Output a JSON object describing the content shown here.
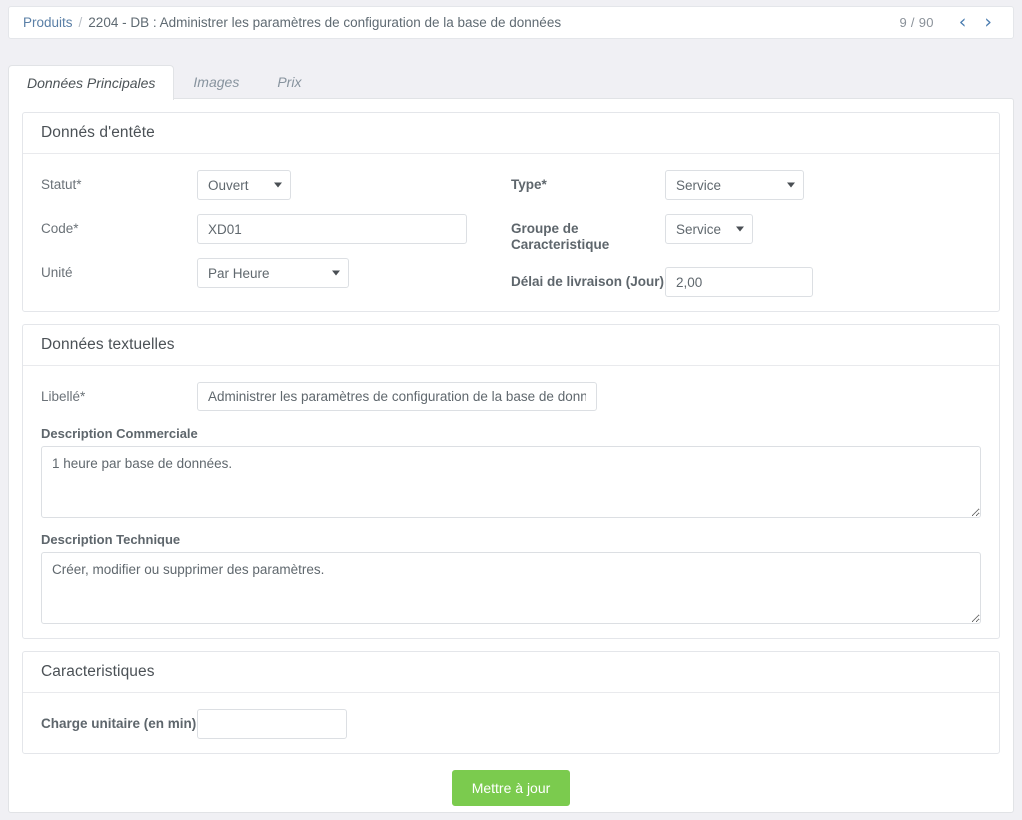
{
  "breadcrumb": {
    "root": "Produits",
    "separator": "/",
    "current": "2204 - DB : Administrer les paramètres de configuration de la base de données"
  },
  "pager": {
    "count": "9 / 90",
    "prev_icon": "chevron-left-icon",
    "prev_glyph": "‹",
    "next_icon": "chevron-right-icon",
    "next_glyph": "›"
  },
  "tabs": [
    {
      "label": "Données Principales",
      "active": true
    },
    {
      "label": "Images",
      "active": false
    },
    {
      "label": "Prix",
      "active": false
    }
  ],
  "panels": {
    "header_data": {
      "title": "Donnés d'entête",
      "fields": {
        "statut": {
          "label": "Statut*",
          "value": "Ouvert"
        },
        "code": {
          "label": "Code*",
          "value": "XD01",
          "placeholder": ""
        },
        "unite": {
          "label": "Unité",
          "value": "Par Heure"
        },
        "type": {
          "label": "Type*",
          "value": "Service"
        },
        "groupe": {
          "label": "Groupe de Caracteristique",
          "value": "Service"
        },
        "delai": {
          "label": "Délai de livraison (Jour)",
          "value": "2,00",
          "placeholder": ""
        }
      }
    },
    "text_data": {
      "title": "Données textuelles",
      "fields": {
        "libelle": {
          "label": "Libellé*",
          "value": "Administrer les paramètres de configuration de la base de données",
          "placeholder": ""
        },
        "description_commerciale": {
          "label": "Description Commerciale",
          "value": "1 heure par base de données.",
          "placeholder": ""
        },
        "description_technique": {
          "label": "Description Technique",
          "value": "Créer, modifier ou supprimer des paramètres.",
          "placeholder": ""
        }
      }
    },
    "characteristics": {
      "title": "Caracteristiques",
      "fields": {
        "charge_unitaire": {
          "label": "Charge unitaire (en min)",
          "value": "",
          "placeholder": ""
        }
      }
    }
  },
  "footer": {
    "submit_label": "Mettre à jour"
  },
  "colors": {
    "page_background": "#f0f0f4",
    "accent_link": "#5a7fa6",
    "submit_green": "#7bcb4e",
    "border": "#e4e6ea",
    "text": "#60686e"
  }
}
